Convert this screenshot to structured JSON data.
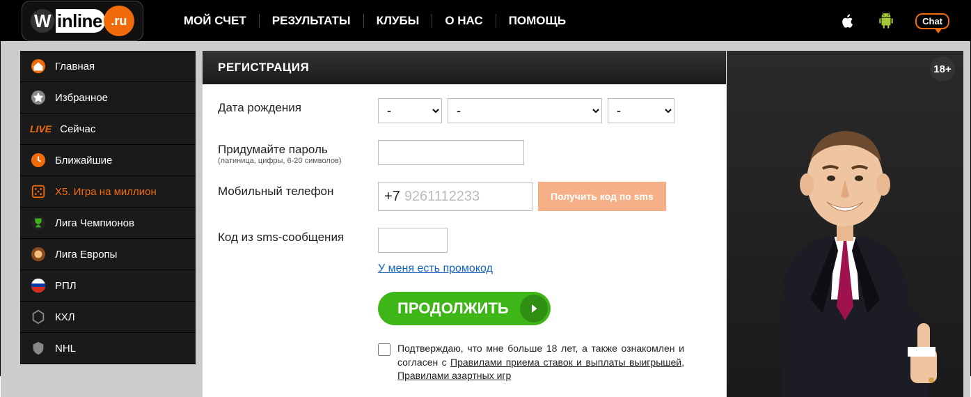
{
  "header": {
    "logo_text_left": "W",
    "logo_text_right": "inline",
    "logo_ru": ".ru",
    "nav": [
      "МОЙ СЧЕТ",
      "РЕЗУЛЬТАТЫ",
      "КЛУБЫ",
      "О НАС",
      "ПОМОЩЬ"
    ],
    "chat_label": "Chat"
  },
  "sidebar": {
    "items": [
      {
        "label": "Главная"
      },
      {
        "label": "Избранное"
      },
      {
        "label": "Сейчас",
        "live_prefix": "LIVE"
      },
      {
        "label": "Ближайшие"
      },
      {
        "label": "X5. Игра на миллион"
      },
      {
        "label": "Лига Чемпионов"
      },
      {
        "label": "Лига Европы"
      },
      {
        "label": "РПЛ"
      },
      {
        "label": "КХЛ"
      },
      {
        "label": "NHL"
      }
    ]
  },
  "form": {
    "title": "РЕГИСТРАЦИЯ",
    "age_badge": "18+",
    "dob_label": "Дата рождения",
    "dob_day": "-",
    "dob_month": "-",
    "dob_year": "-",
    "pwd_label": "Придумайте пароль",
    "pwd_hint": "(латиница, цифры, 6-20 символов)",
    "phone_label": "Мобильный телефон",
    "phone_prefix": "+7",
    "phone_placeholder": "9261112233",
    "sms_btn": "Получить код по sms",
    "sms_code_label": "Код из sms-сообщения",
    "promo_link": "У меня есть промокод",
    "continue": "ПРОДОЛЖИТЬ",
    "consent_text_1": "Подтверждаю, что мне больше 18 лет, а также ознакомлен и согласен с ",
    "consent_link_1": "Правилами приема ставок и выплаты выигрышей",
    "consent_sep": ", ",
    "consent_link_2": "Правилами азартных игр"
  }
}
